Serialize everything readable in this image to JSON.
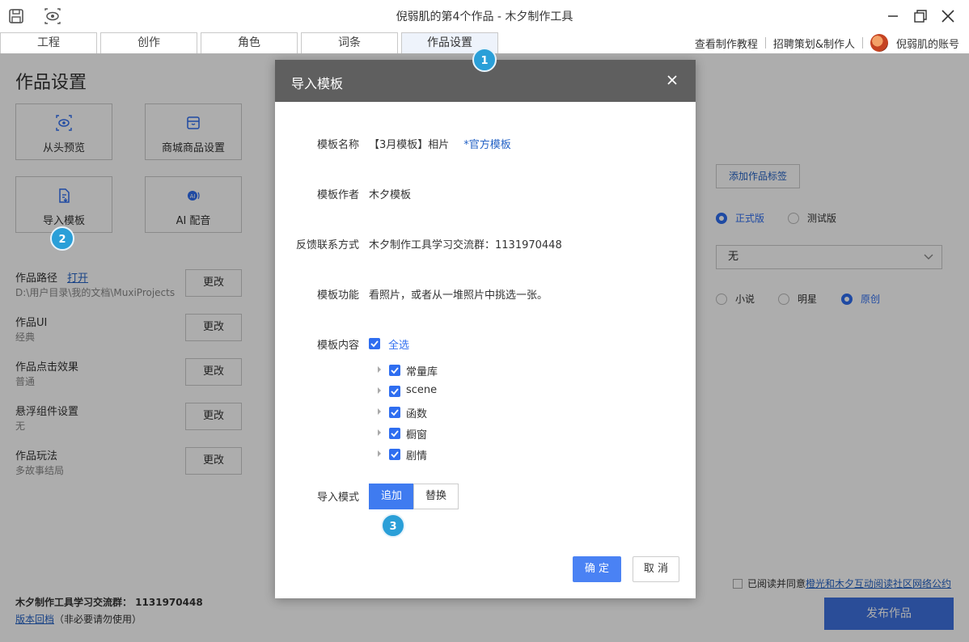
{
  "window": {
    "title": "倪弱肌的第4个作品 - 木夕制作工具"
  },
  "tabs": [
    {
      "label": "工程",
      "active": false
    },
    {
      "label": "创作",
      "active": false
    },
    {
      "label": "角色",
      "active": false
    },
    {
      "label": "词条",
      "active": false
    },
    {
      "label": "作品设置",
      "active": true
    }
  ],
  "toplinks": {
    "tutorial": "查看制作教程",
    "recruit": "招聘策划&制作人",
    "account": "倪弱肌的账号"
  },
  "left": {
    "title": "作品设置",
    "cards": [
      {
        "label": "从头预览",
        "icon": "eye-preview-icon"
      },
      {
        "label": "商城商品设置",
        "icon": "store-icon"
      },
      {
        "label": "导入模板",
        "icon": "document-import-icon"
      },
      {
        "label": "AI 配音",
        "icon": "ai-voice-icon"
      }
    ],
    "settings": [
      {
        "name": "作品路径",
        "link": "打开",
        "value": "D:\\用户目录\\我的文档\\MuxiProjects",
        "button": "更改"
      },
      {
        "name": "作品UI",
        "value": "经典",
        "button": "更改"
      },
      {
        "name": "作品点击效果",
        "value": "普通",
        "button": "更改"
      },
      {
        "name": "悬浮组件设置",
        "value": "无",
        "button": "更改"
      },
      {
        "name": "作品玩法",
        "value": "多故事结局",
        "button": "更改"
      }
    ],
    "footer": {
      "group": "木夕制作工具学习交流群：  1131970448",
      "rollback": "版本回档",
      "rollback_note": "（非必要请勿使用）"
    }
  },
  "right": {
    "add_tag_button": "添加作品标签",
    "version_options": [
      {
        "label": "正式版",
        "selected": true
      },
      {
        "label": "测试版",
        "selected": false
      }
    ],
    "select_value": "无",
    "category_options": [
      {
        "label": "小说",
        "selected": false
      },
      {
        "label": "明星",
        "selected": false
      },
      {
        "label": "原创",
        "selected": true
      }
    ],
    "agree_text": "已阅读并同意",
    "agree_link": "橙光和木夕互动阅读社区网络公约",
    "publish_button": "发布作品"
  },
  "modal": {
    "title": "导入模板",
    "fields": {
      "name_label": "模板名称",
      "name_value": "【3月模板】相片",
      "name_tag": "*官方模板",
      "author_label": "模板作者",
      "author_value": "木夕模板",
      "contact_label": "反馈联系方式",
      "contact_value": "木夕制作工具学习交流群：1131970448",
      "function_label": "模板功能",
      "function_value": "看照片，或者从一堆照片中挑选一张。",
      "content_label": "模板内容",
      "select_all": "全选"
    },
    "content_items": [
      {
        "label": "常量库",
        "checked": true
      },
      {
        "label": "scene",
        "checked": true
      },
      {
        "label": "函数",
        "checked": true
      },
      {
        "label": "橱窗",
        "checked": true
      },
      {
        "label": "剧情",
        "checked": true
      }
    ],
    "mode_label": "导入模式",
    "mode_options": [
      {
        "label": "追加",
        "selected": true
      },
      {
        "label": "替换",
        "selected": false
      }
    ],
    "ok_button": "确 定",
    "cancel_button": "取 消"
  },
  "badges": [
    "1",
    "2",
    "3"
  ],
  "colors": {
    "accent": "#2f6ef0",
    "badge": "#2a9fd8",
    "modal_header": "#5f5f5f",
    "publish": "#3f72e0"
  }
}
